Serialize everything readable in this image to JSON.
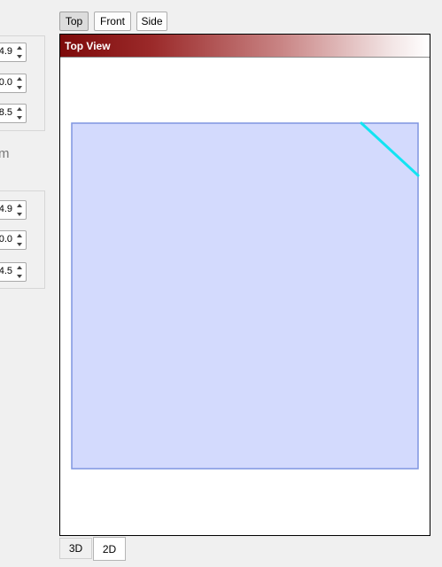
{
  "left_panel": {
    "group1": {
      "values": [
        "4.9",
        "0.0",
        "8.5"
      ]
    },
    "unit": "m",
    "group2": {
      "values": [
        "4.9",
        "0.0",
        "4.5"
      ]
    }
  },
  "toolbar": {
    "top_label": "Top",
    "front_label": "Front",
    "side_label": "Side",
    "active": "Top"
  },
  "viewport": {
    "title": "Top View",
    "colors": {
      "rect_fill": "#d3dafd",
      "rect_stroke": "#7f95e0",
      "line": "#12e4f2"
    }
  },
  "tabs": {
    "tab_3d": "3D",
    "tab_2d": "2D",
    "active": "2D"
  }
}
